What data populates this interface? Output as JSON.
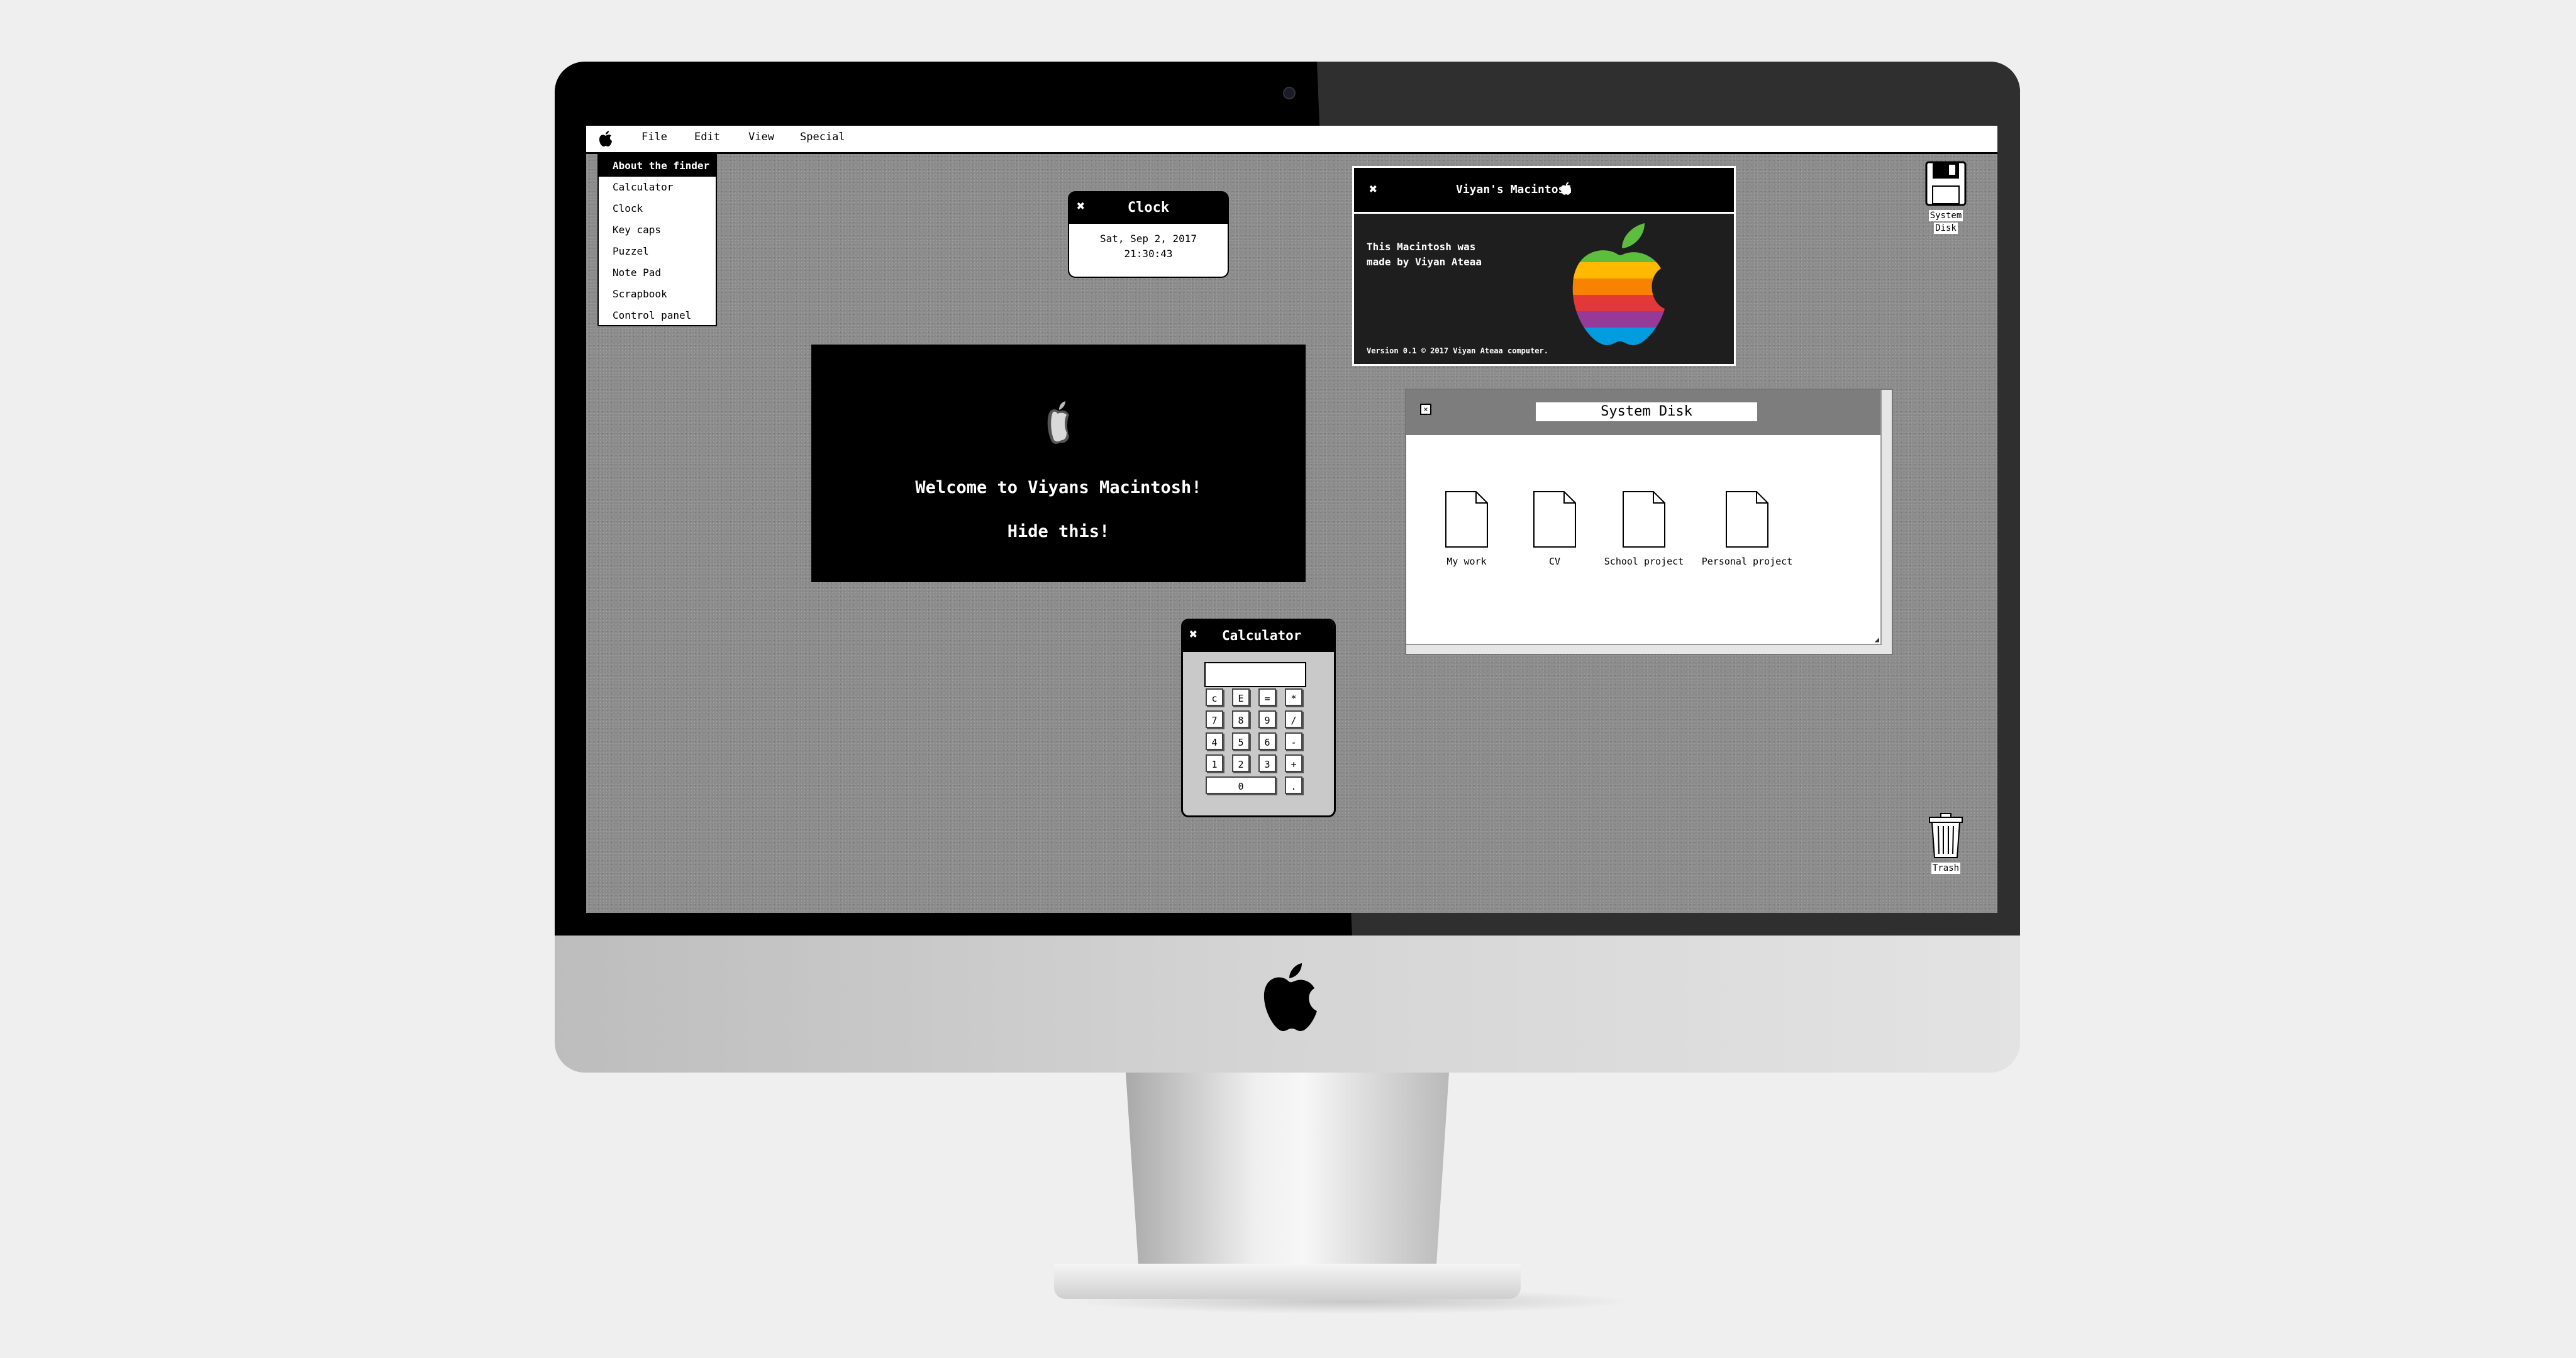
{
  "menubar": {
    "apple_icon": "apple-icon",
    "items": [
      "File",
      "Edit",
      "View",
      "Special"
    ]
  },
  "apple_menu": {
    "items": [
      "About the finder",
      "Calculator",
      "Clock",
      "Key caps",
      "Puzzel",
      "Note Pad",
      "Scrapbook",
      "Control panel"
    ],
    "selected_index": 0
  },
  "clock_window": {
    "title": "Clock",
    "date": "Sat, Sep 2, 2017",
    "time": "21:30:43",
    "close_icon": "close-icon"
  },
  "welcome_window": {
    "heading": "Welcome to Viyans Macintosh!",
    "hide_link": "Hide this!"
  },
  "about_window": {
    "title": "Viyan's Macintosh",
    "body_line1": "This Macintosh was",
    "body_line2": "made by Viyan Ateaa",
    "footer": "Version 0.1 © 2017 Viyan Ateaa computer.",
    "logo_colors": [
      "#5ebd3e",
      "#ffb900",
      "#f78200",
      "#e23838",
      "#973999",
      "#009cdf"
    ]
  },
  "system_disk_window": {
    "title": "System Disk",
    "files": [
      "My work",
      "CV",
      "School project",
      "Personal project"
    ]
  },
  "calculator": {
    "title": "Calculator",
    "display": "",
    "keys": [
      "c",
      "E",
      "=",
      "*",
      "7",
      "8",
      "9",
      "/",
      "4",
      "5",
      "6",
      "-",
      "1",
      "2",
      "3",
      "+",
      "0",
      "."
    ]
  },
  "desktop_icons": {
    "disk_label_1": "System",
    "disk_label_2": "Disk",
    "trash_label": "Trash"
  }
}
